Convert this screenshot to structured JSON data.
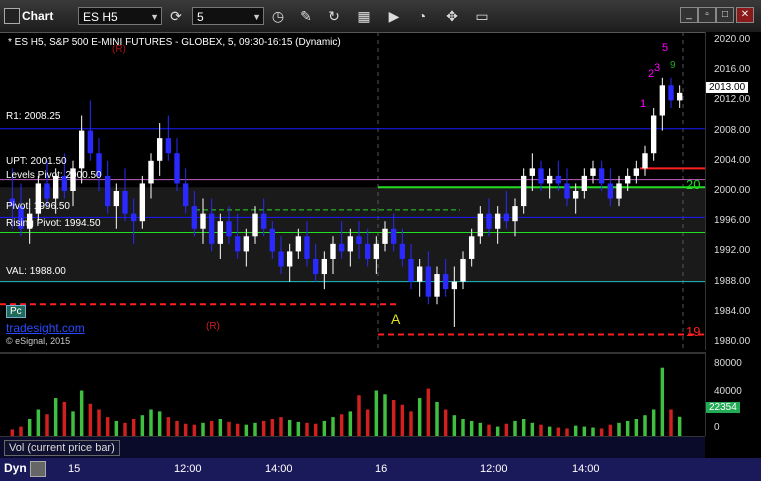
{
  "toolbar": {
    "title": "Chart",
    "symbol": "ES H5",
    "interval": "5"
  },
  "chart": {
    "header": "* ES H5, S&P 500 E-MINI FUTURES - GLOBEX, 5, 09:30-16:15 (Dynamic)",
    "watermark": "tradesight.com",
    "copyright": "© eSignal, 2015",
    "pc_button": "Pc",
    "current_price": "2013.00",
    "level_labels": {
      "r1": "R1: 2008.25",
      "upt": "UPT: 2001.50",
      "levels_pivot": "Levels Pivot: 2000.50",
      "pivot": "Pivot: 1996.50",
      "rising_pivot": "Rising Pivot: 1994.50",
      "val": "VAL: 1988.00"
    },
    "markers": {
      "a": "A",
      "r_top": "(R)",
      "r_bottom": "(R)",
      "count_20": "20",
      "count_19": "19",
      "seq_5": "5",
      "seq_3": "3",
      "seq_2": "2",
      "seq_1": "1",
      "seq_9": "9"
    },
    "price_ticks": [
      "2020.00",
      "2016.00",
      "2012.00",
      "2008.00",
      "2004.00",
      "2000.00",
      "1996.00",
      "1992.00",
      "1988.00",
      "1984.00",
      "1980.00"
    ],
    "colors": {
      "up": "#ffffff",
      "down": "#2a2aff",
      "r1": "#1a1aff",
      "pivot_green": "#22dd22",
      "red": "#ff2020",
      "val": "#20c0c0",
      "magenta": "#ff00ff"
    }
  },
  "volume": {
    "legend": "Vol (current price bar)",
    "last_value": "22354",
    "ticks": [
      "80000",
      "40000",
      "0"
    ]
  },
  "time_axis": {
    "dyn_label": "Dyn",
    "labels": [
      "15",
      "12:00",
      "14:00",
      "16",
      "12:00",
      "14:00"
    ]
  },
  "chart_data": {
    "type": "candlestick",
    "symbol": "ES H5",
    "ylim": [
      1980,
      2020
    ],
    "candles": [
      [
        1999,
        2003,
        1995,
        1998
      ],
      [
        1998,
        2001,
        1994,
        1995
      ],
      [
        1995,
        1999,
        1993,
        1997
      ],
      [
        1997,
        2002,
        1996,
        2001
      ],
      [
        2001,
        2004,
        1998,
        1999
      ],
      [
        1999,
        2003,
        1997,
        2002
      ],
      [
        2002,
        2005,
        1999,
        2000
      ],
      [
        2000,
        2004,
        1998,
        2003
      ],
      [
        2003,
        2010,
        2001,
        2008
      ],
      [
        2008,
        2012,
        2004,
        2005
      ],
      [
        2005,
        2007,
        2000,
        2002
      ],
      [
        2002,
        2004,
        1997,
        1998
      ],
      [
        1998,
        2001,
        1995,
        2000
      ],
      [
        2000,
        2003,
        1996,
        1997
      ],
      [
        1997,
        1999,
        1993,
        1996
      ],
      [
        1996,
        2002,
        1995,
        2001
      ],
      [
        2001,
        2005,
        1999,
        2004
      ],
      [
        2004,
        2009,
        2002,
        2007
      ],
      [
        2007,
        2010,
        2004,
        2005
      ],
      [
        2005,
        2007,
        2000,
        2001
      ],
      [
        2001,
        2003,
        1997,
        1998
      ],
      [
        1998,
        2000,
        1994,
        1995
      ],
      [
        1995,
        1999,
        1993,
        1997
      ],
      [
        1997,
        1999,
        1992,
        1993
      ],
      [
        1993,
        1997,
        1991,
        1996
      ],
      [
        1996,
        1998,
        1993,
        1994
      ],
      [
        1994,
        1997,
        1991,
        1992
      ],
      [
        1992,
        1995,
        1990,
        1994
      ],
      [
        1994,
        1998,
        1993,
        1997
      ],
      [
        1997,
        1999,
        1994,
        1995
      ],
      [
        1995,
        1996,
        1991,
        1992
      ],
      [
        1992,
        1994,
        1989,
        1990
      ],
      [
        1990,
        1993,
        1988,
        1992
      ],
      [
        1992,
        1995,
        1991,
        1994
      ],
      [
        1994,
        1996,
        1990,
        1991
      ],
      [
        1991,
        1993,
        1988,
        1989
      ],
      [
        1989,
        1992,
        1987,
        1991
      ],
      [
        1991,
        1994,
        1989,
        1993
      ],
      [
        1993,
        1996,
        1991,
        1992
      ],
      [
        1992,
        1995,
        1990,
        1994
      ],
      [
        1994,
        1996,
        1991,
        1993
      ],
      [
        1993,
        1995,
        1990,
        1991
      ],
      [
        1991,
        1994,
        1989,
        1993
      ],
      [
        1993,
        1996,
        1992,
        1995
      ],
      [
        1995,
        1997,
        1992,
        1993
      ],
      [
        1993,
        1995,
        1990,
        1991
      ],
      [
        1991,
        1993,
        1987,
        1988
      ],
      [
        1988,
        1991,
        1986,
        1990
      ],
      [
        1990,
        1992,
        1985,
        1986
      ],
      [
        1986,
        1990,
        1985,
        1989
      ],
      [
        1989,
        1991,
        1986,
        1987
      ],
      [
        1987,
        1990,
        1982,
        1988
      ],
      [
        1988,
        1992,
        1987,
        1991
      ],
      [
        1991,
        1995,
        1990,
        1994
      ],
      [
        1994,
        1998,
        1993,
        1997
      ],
      [
        1997,
        1999,
        1994,
        1995
      ],
      [
        1995,
        1998,
        1993,
        1997
      ],
      [
        1997,
        2000,
        1995,
        1996
      ],
      [
        1996,
        1999,
        1994,
        1998
      ],
      [
        1998,
        2003,
        1997,
        2002
      ],
      [
        2002,
        2005,
        2000,
        2003
      ],
      [
        2003,
        2004,
        2000,
        2001
      ],
      [
        2001,
        2003,
        1999,
        2002
      ],
      [
        2002,
        2004,
        2000,
        2001
      ],
      [
        2001,
        2003,
        1998,
        1999
      ],
      [
        1999,
        2001,
        1997,
        2000
      ],
      [
        2000,
        2003,
        1999,
        2002
      ],
      [
        2002,
        2004,
        2001,
        2003
      ],
      [
        2003,
        2004,
        2000,
        2001
      ],
      [
        2001,
        2003,
        1998,
        1999
      ],
      [
        1999,
        2002,
        1998,
        2001
      ],
      [
        2001,
        2003,
        2000,
        2002
      ],
      [
        2002,
        2004,
        2001,
        2003
      ],
      [
        2003,
        2006,
        2002,
        2005
      ],
      [
        2005,
        2011,
        2004,
        2010
      ],
      [
        2010,
        2015,
        2008,
        2014
      ],
      [
        2014,
        2015,
        2011,
        2012
      ],
      [
        2012,
        2014,
        2011,
        2013
      ]
    ],
    "volume": [
      9000,
      12000,
      20000,
      30000,
      25000,
      42000,
      38000,
      28000,
      50000,
      36000,
      30000,
      22000,
      18000,
      16000,
      20000,
      24000,
      30000,
      28000,
      22000,
      18000,
      15000,
      14000,
      16000,
      18000,
      20000,
      17000,
      15000,
      14000,
      16000,
      18000,
      20000,
      22000,
      19000,
      17000,
      16000,
      15000,
      18000,
      22000,
      25000,
      28000,
      45000,
      30000,
      50000,
      46000,
      40000,
      35000,
      28000,
      42000,
      52000,
      38000,
      30000,
      24000,
      20000,
      18000,
      16000,
      14000,
      12000,
      15000,
      18000,
      20000,
      16000,
      14000,
      12000,
      11000,
      10000,
      13000,
      12000,
      11000,
      10000,
      14000,
      16000,
      18000,
      20000,
      24000,
      30000,
      74000,
      30000,
      22354
    ]
  }
}
